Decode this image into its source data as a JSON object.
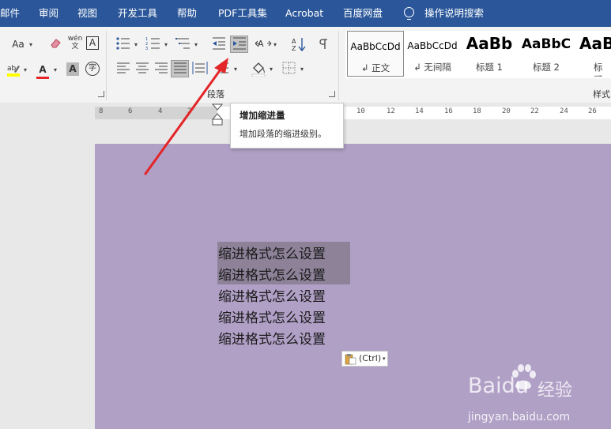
{
  "menu": {
    "items": [
      "邮件",
      "审阅",
      "视图",
      "开发工具",
      "帮助",
      "PDF工具集",
      "Acrobat",
      "百度网盘"
    ],
    "search_label": "操作说明搜索"
  },
  "ribbon": {
    "paragraph_group_label": "段落",
    "styles_group_label": "样式",
    "font_button_label": "Aa",
    "phonetic_top": "wén",
    "phonetic_bottom": "文",
    "char_border": "A",
    "font_color_glyph": "A",
    "shade_glyph": "A",
    "enclose_glyph": "字",
    "styles": [
      {
        "sample": "AaBbCcDd",
        "name": "↲ 正文"
      },
      {
        "sample": "AaBbCcDd",
        "name": "↲ 无间隔"
      },
      {
        "sample": "AaBb",
        "name": "标题 1"
      },
      {
        "sample": "AaBbC",
        "name": "标题 2"
      },
      {
        "sample": "AaBl",
        "name": "标题"
      }
    ]
  },
  "ruler": {
    "labels": [
      "8",
      "6",
      "4",
      "2",
      "10",
      "12",
      "14",
      "16",
      "18",
      "20",
      "22",
      "24",
      "26"
    ]
  },
  "tooltip": {
    "title": "增加缩进量",
    "description": "增加段落的缩进级别。"
  },
  "document": {
    "lines": [
      "缩进格式怎么设置",
      "缩进格式怎么设置",
      "缩进格式怎么设置",
      "缩进格式怎么设置",
      "缩进格式怎么设置"
    ]
  },
  "paste_options": {
    "label": "(Ctrl)"
  },
  "watermark": {
    "brand": "Baidu",
    "product": "经验",
    "url": "jingyan.baidu.com"
  },
  "colors": {
    "title_bar": "#2b579a",
    "page_background": "#b0a0c6",
    "selection": "#8d8298",
    "annotation_arrow": "#e32528"
  }
}
